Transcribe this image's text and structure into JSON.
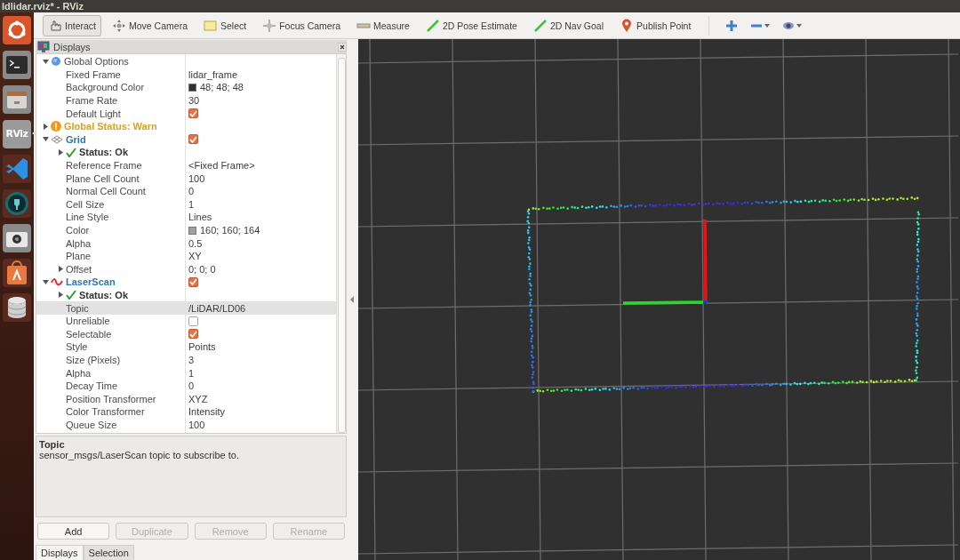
{
  "window": {
    "title": "ldlidar.rviz* - RViz"
  },
  "launcher": [
    {
      "kind": "ubuntu",
      "active": false
    },
    {
      "kind": "terminal",
      "active": false
    },
    {
      "kind": "files",
      "active": false
    },
    {
      "kind": "rviz",
      "label": "RViz",
      "active": true
    },
    {
      "kind": "vscode",
      "active": false
    },
    {
      "kind": "keyring",
      "active": false
    },
    {
      "kind": "camera",
      "active": false
    },
    {
      "kind": "software",
      "active": false
    },
    {
      "kind": "database",
      "active": false
    }
  ],
  "tools": [
    {
      "kind": "interact",
      "label": "Interact",
      "selected": true
    },
    {
      "kind": "move",
      "label": "Move Camera",
      "selected": false
    },
    {
      "kind": "select",
      "label": "Select",
      "selected": false
    },
    {
      "kind": "focus",
      "label": "Focus Camera",
      "selected": false
    },
    {
      "kind": "measure",
      "label": "Measure",
      "selected": false
    },
    {
      "kind": "pose",
      "label": "2D Pose Estimate",
      "selected": false
    },
    {
      "kind": "goal",
      "label": "2D Nav Goal",
      "selected": false
    },
    {
      "kind": "point",
      "label": "Publish Point",
      "selected": false
    }
  ],
  "view_buttons": [
    {
      "kind": "add",
      "dropdown": false
    },
    {
      "kind": "minus",
      "dropdown": true
    },
    {
      "kind": "eye",
      "dropdown": true
    }
  ],
  "displays_panel": {
    "title": "Displays",
    "tree": [
      {
        "kind": "options",
        "label": "Global Options",
        "expanded": true,
        "selected": false,
        "children": [
          {
            "kind": "property",
            "label": "Fixed Frame",
            "value": "lidar_frame",
            "selected": false
          },
          {
            "kind": "property",
            "label": "Background Color",
            "value": "48; 48; 48",
            "color": "#303030",
            "selected": false
          },
          {
            "kind": "property",
            "label": "Frame Rate",
            "value": "30",
            "selected": false
          },
          {
            "kind": "property",
            "label": "Default Light",
            "checked": true,
            "selected": false
          }
        ]
      },
      {
        "kind": "warn",
        "label": "Global Status: Warn",
        "expanded": false,
        "selected": false
      },
      {
        "kind": "grid",
        "label": "Grid",
        "expanded": true,
        "checked": true,
        "selected": false,
        "children": [
          {
            "kind": "ok",
            "label": "Status: Ok",
            "expanded": false,
            "selected": false
          },
          {
            "kind": "property",
            "label": "Reference Frame",
            "value": "<Fixed Frame>",
            "selected": false
          },
          {
            "kind": "property",
            "label": "Plane Cell Count",
            "value": "100",
            "selected": false
          },
          {
            "kind": "property",
            "label": "Normal Cell Count",
            "value": "0",
            "selected": false
          },
          {
            "kind": "property",
            "label": "Cell Size",
            "value": "1",
            "selected": false
          },
          {
            "kind": "property",
            "label": "Line Style",
            "value": "Lines",
            "selected": false
          },
          {
            "kind": "property",
            "label": "Color",
            "value": "160; 160; 164",
            "color": "#a0a0a4",
            "selected": false
          },
          {
            "kind": "property",
            "label": "Alpha",
            "value": "0.5",
            "selected": false
          },
          {
            "kind": "property",
            "label": "Plane",
            "value": "XY",
            "selected": false
          },
          {
            "kind": "property",
            "label": "Offset",
            "value": "0; 0; 0",
            "expanded": false,
            "selected": false
          }
        ]
      },
      {
        "kind": "laserscan",
        "label": "LaserScan",
        "expanded": true,
        "checked": true,
        "selected": false,
        "children": [
          {
            "kind": "ok",
            "label": "Status: Ok",
            "expanded": false,
            "selected": false
          },
          {
            "kind": "property",
            "label": "Topic",
            "value": "/LiDAR/LD06",
            "selected": true
          },
          {
            "kind": "property",
            "label": "Unreliable",
            "checked": false,
            "selected": false
          },
          {
            "kind": "property",
            "label": "Selectable",
            "checked": true,
            "selected": false
          },
          {
            "kind": "property",
            "label": "Style",
            "value": "Points",
            "selected": false
          },
          {
            "kind": "property",
            "label": "Size (Pixels)",
            "value": "3",
            "selected": false
          },
          {
            "kind": "property",
            "label": "Alpha",
            "value": "1",
            "selected": false
          },
          {
            "kind": "property",
            "label": "Decay Time",
            "value": "0",
            "selected": false
          },
          {
            "kind": "property",
            "label": "Position Transformer",
            "value": "XYZ",
            "selected": false
          },
          {
            "kind": "property",
            "label": "Color Transformer",
            "value": "Intensity",
            "selected": false
          },
          {
            "kind": "property",
            "label": "Queue Size",
            "value": "100",
            "selected": false
          }
        ]
      }
    ],
    "description": {
      "title": "Topic",
      "text": "sensor_msgs/LaserScan topic to subscribe to."
    },
    "buttons": [
      {
        "label": "Add",
        "disabled": false
      },
      {
        "label": "Duplicate",
        "disabled": true
      },
      {
        "label": "Remove",
        "disabled": true
      },
      {
        "label": "Rename",
        "disabled": true
      }
    ],
    "tabs": [
      {
        "label": "Displays",
        "selected": true
      },
      {
        "label": "Selection",
        "selected": false
      }
    ]
  }
}
